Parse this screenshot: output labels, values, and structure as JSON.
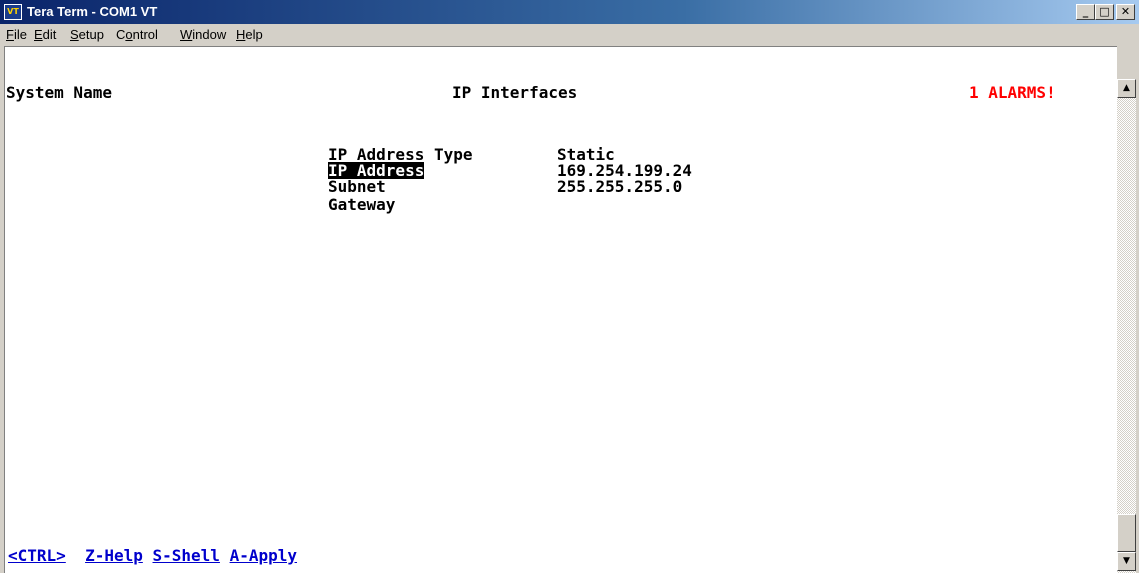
{
  "window": {
    "title": "Tera Term - COM1 VT",
    "icon_text": "VT",
    "controls": {
      "minimize": "_",
      "maximize": "□",
      "close": "✕"
    }
  },
  "menu": [
    {
      "key": "F",
      "rest": "ile"
    },
    {
      "key": "E",
      "rest": "dit"
    },
    {
      "key": "S",
      "rest": "etup"
    },
    {
      "key": "o",
      "pre": "C",
      "rest": "ntrol"
    },
    {
      "key": "W",
      "rest": "indow"
    },
    {
      "key": "H",
      "rest": "elp"
    }
  ],
  "screen": {
    "system_name": "System Name",
    "title": "IP Interfaces",
    "alarms": "1 ALARMS!",
    "fields": [
      {
        "label": "IP Address Type",
        "value": "Static"
      },
      {
        "label": "IP Address",
        "value": "169.254.199.24",
        "selected": true
      },
      {
        "label": "Subnet",
        "value": "255.255.255.0"
      },
      {
        "label": "Gateway",
        "value": ""
      }
    ],
    "footer": {
      "ctrl": "<CTRL>",
      "help": "Z-Help",
      "shell": "S-Shell",
      "apply": "A-Apply"
    }
  },
  "scrollbar": {
    "up": "▲",
    "down": "▼"
  }
}
